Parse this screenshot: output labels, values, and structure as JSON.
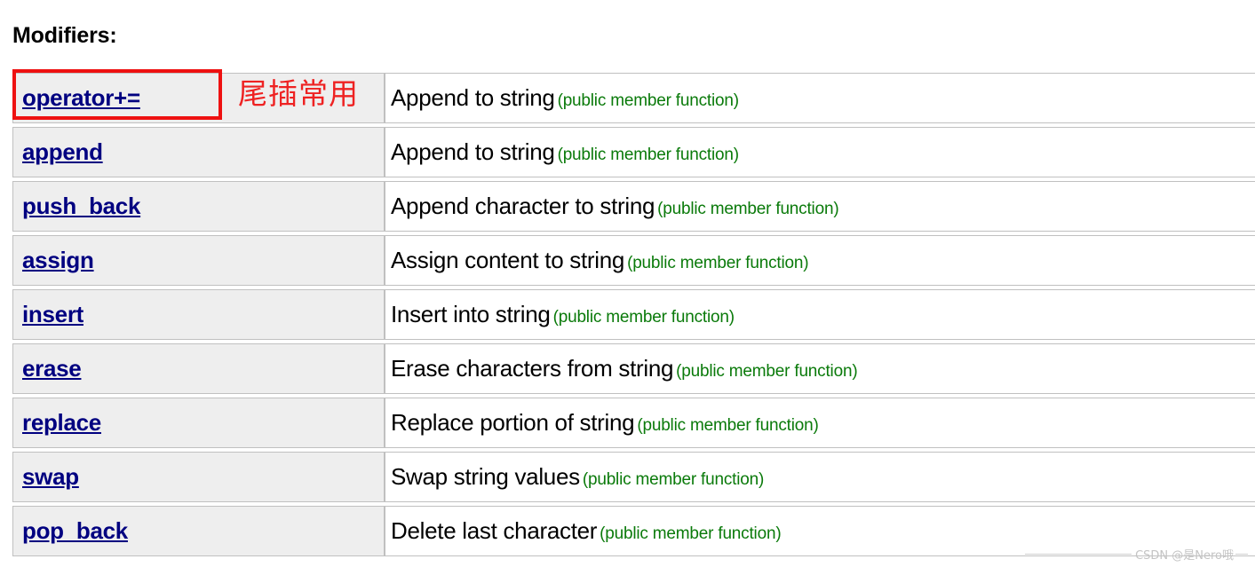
{
  "page": {
    "title": "Modifiers:"
  },
  "annotation": {
    "note_text": "尾插常用",
    "note_color": "#ee2222",
    "highlight_color": "#ee1111",
    "highlight_target": "operator+="
  },
  "table": {
    "member_column_bg": "#eeeeee",
    "desc_column_bg": "#ffffff",
    "border_color": "#c0c0c0",
    "link_color": "#000080",
    "note_color": "#0a7a0a",
    "rows": [
      {
        "member": "operator+=",
        "description": "Append to string",
        "note": "(public member function)"
      },
      {
        "member": "append",
        "description": "Append to string",
        "note": "(public member function)"
      },
      {
        "member": "push_back",
        "description": "Append character to string",
        "note": "(public member function)"
      },
      {
        "member": "assign",
        "description": "Assign content to string",
        "note": "(public member function)"
      },
      {
        "member": "insert",
        "description": "Insert into string",
        "note": "(public member function)"
      },
      {
        "member": "erase",
        "description": "Erase characters from string",
        "note": "(public member function)"
      },
      {
        "member": "replace",
        "description": "Replace portion of string",
        "note": "(public member function)"
      },
      {
        "member": "swap",
        "description": "Swap string values",
        "note": "(public member function)"
      },
      {
        "member": "pop_back",
        "description": "Delete last character",
        "note": "(public member function)"
      }
    ]
  },
  "watermark": {
    "text": "CSDN @是Nero哦"
  }
}
